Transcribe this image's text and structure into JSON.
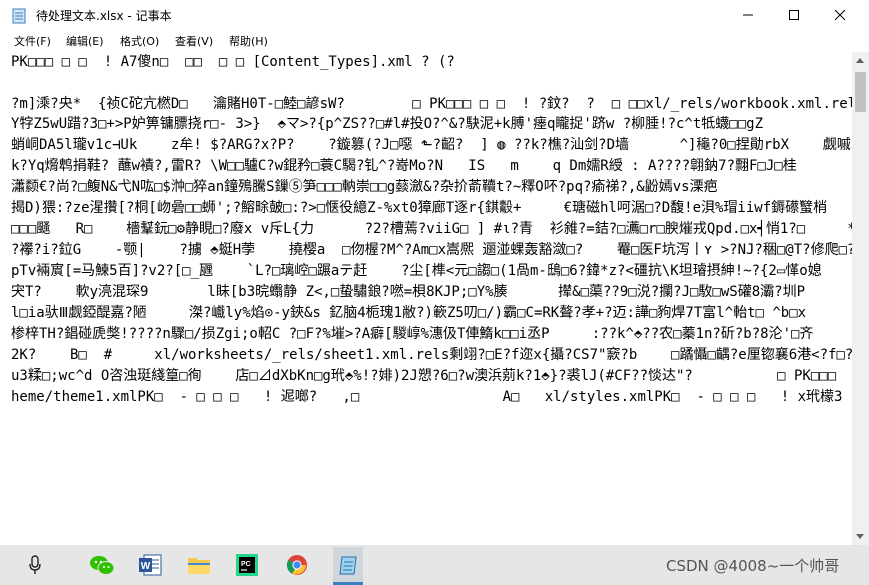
{
  "window": {
    "title": "待处理文本.xlsx - 记事本"
  },
  "menu": [
    "文件(F)",
    "编辑(E)",
    "格式(O)",
    "查看(V)",
    "帮助(H)"
  ],
  "lines": [
    "PK□□□ □ □  ! A7傻n□  □□  □ □ [Content_Types].xml ? (?",
    "",
    "?m]溗?央*  {祯C砣亢橪D□   瀹賭H0T-□鯥□諺sW?        □ PK□□□ □ □  ! ?鈫?  ?  □ □□xl/_rels/workbook.xml.rels ?",
    "Y牸Z5wU踖?3□+>P妒箅镛膘挠r□- 3>}  ⬘マ>?{p^ZS??□#l#投O?^&?駃泥+k膊'瘗q矓捉'跻w ?柳腄!?c^t牴蠛□□gZ",
    "蛸峒DA5l瓏v1c⊣Uk    z牟! $?ARG?x?P?    ?鏇篡(?J□噁 ⬑?齠?  ] ◍ ??k?樵?汕剑?D墙      ^]龝?0□捏勛rbX    觑嘁 ◂ -",
    "k?Yq熁鹎捐鞋? 蘸w襀?,雷R? \\W□□驢C?w錕矜□蓑C騔?钆^?嵜Mo?N   IS   m    q Dm嬬R綬 : A????翶鈉7?翲F□J□桂",
    "瀟颣€?尚?□鰒N&弋N吰□$浺□猝an鐘殦騰S鏁⑤笋□□□軜崇□□g䕭瀲&?杂扴萮韇t?~釋O吥?pq?瘉祶?,&鼢嫣vs溧疤",
    "揭D)猥:?ze湦攢[?桐[岉碞□□蛳';?鰫畭皷□:?>□惬役繶Z-%xt0獐廊T逐r{錤鷇+     €瑭磁hl呵涺□?D馥!e浿%瑁iiwf鎒礤蠥梢",
    "□□□颾   R□    檣鞤鈨□⚙静睍□?廢x v斥L{力      ?2?槽蔫?viiG□ ] #ι?青  衫雓?=銡?□瀳□r□腴熣戎Qpd.□x┥悄1?□     *库2T?",
    "?襻?i?鉝G    -颚|    ?擄 ⬘蜓H荸    撓樱a  □伆楃?M^?Am□x嵩熈 逦湴蜾轰豁潋□?    罨□医F坑泻丨ʏ >?NJ?稇□@T?修爬□?",
    "pTv裲賔[=马鰊5百]?v2?[□_甅    `L?□璃崆□蹍aテ赶    ?尘[榫<元□謅□(1咼m-鴟□6?鍏*z?<礓抗\\K坦璿摂紳!~?{2▭愅o媳",
    "宊T?    軟y湸混琛9       l眛[b3晥蠮静 Z<,□蛰驌鋃?嘫=梖8KJP;□Y%腠      撵&□蕖??9□涚?攔?J□駇□wS礶8灞?圳P         (余丞",
    "l□ia驮Ⅲ觑錏醍嘉?陋     滐?巇ly%焰⊙-y鋏&s 釔脑4栀瑰1敝?)簐Z5叨□/)霸□C=RK聱?孝+?迈:譁□豞焊7T富l^軩t□ ^b□x",
    "椮梓TH?錩碰虒獘!????n驟□/损Zgi;o軺C ?□F?%墔>?A癖[騣崞%潓伋T俥鰖k□□i丞P     :??k^⬘??农□蓁1n?斫?b?8沦'□齐",
    "2K?    B□  #     xl/worksheets/_rels/sheet1.xml.rels剩翊?□E?f迩x{攝?CS7\"窾?b    □蹫懾□齵?e厘锪襄6港<?f□?院  呬c□",
    "u3糅□;wc^d O咨浊珽綫篁□徇    店□⊿dXbKn□g玳⬘%!?婔)2J愬?6□?w澳浜莂k?1⬘}?裘lJ(#CF??惔达\"?          □ PK□□□",
    "heme/theme1.xmlPK□  - □ □ □   ! 迡啷?   ,□                 A□   xl/styles.xmlPK□  - □ □ □   ! x玳檬3  鍋  □           b□  x"
  ],
  "taskbar": {
    "icons": [
      "microphone-icon",
      "wechat-icon",
      "word-icon",
      "file-explorer-icon",
      "pycharm-icon",
      "chrome-icon",
      "notepad-icon"
    ],
    "watermark": "CSDN @4008~一个帅哥"
  }
}
